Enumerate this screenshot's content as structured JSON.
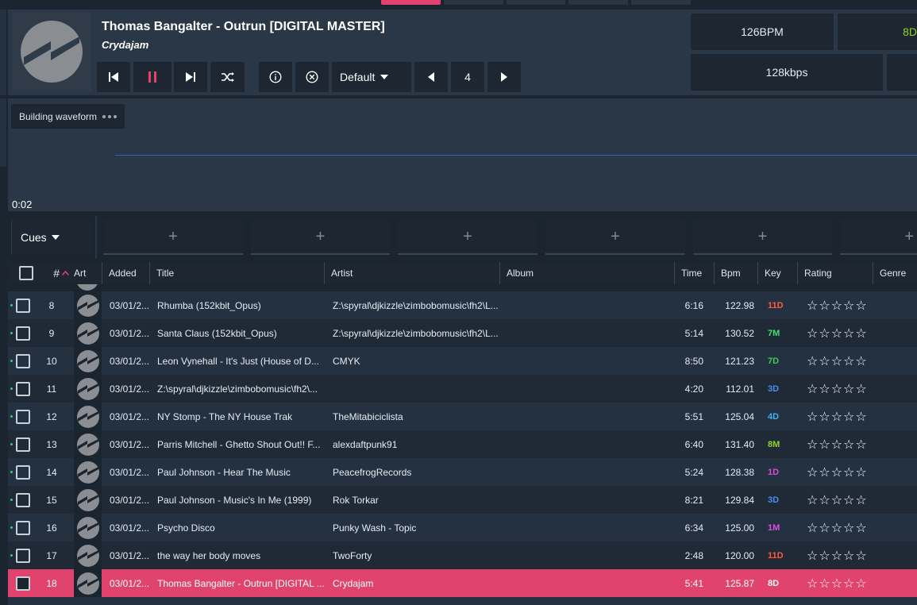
{
  "deck": {
    "title": "Thomas Bangalter - Outrun [DIGITAL MASTER]",
    "artist": "Crydajam",
    "hotcue_preset": "Default",
    "loop_value": "4",
    "bpm": "126BPM",
    "key": "8D",
    "bitrate": "128kbps"
  },
  "waveform": {
    "status": "Building waveform",
    "elapsed": "0:02"
  },
  "cues": {
    "select_label": "Cues",
    "slots": [
      "+",
      "+",
      "+",
      "+",
      "+",
      "+"
    ]
  },
  "table": {
    "headers": {
      "num": "#",
      "art": "Art",
      "added": "Added",
      "title": "Title",
      "artist": "Artist",
      "album": "Album",
      "time": "Time",
      "bpm": "Bpm",
      "key": "Key",
      "rating": "Rating",
      "genre": "Genre"
    },
    "rows": [
      {
        "num": "8",
        "added": "03/01/2...",
        "title": "Rhumba (152kbit_Opus)",
        "artist": "Z:\\spyral\\djkizzle\\zimbobomusic\\fh2\\L...",
        "album": "",
        "time": "6:16",
        "bpm": "122.98",
        "key": "11D",
        "key_color": "#ff5a3c"
      },
      {
        "num": "9",
        "added": "03/01/2...",
        "title": "Santa Claus (152kbit_Opus)",
        "artist": "Z:\\spyral\\djkizzle\\zimbobomusic\\fh2\\L...",
        "album": "",
        "time": "5:14",
        "bpm": "130.52",
        "key": "7M",
        "key_color": "#3ee36a"
      },
      {
        "num": "10",
        "added": "03/01/2...",
        "title": "Leon Vynehall - It's Just (House of D...",
        "artist": "CMYK",
        "album": "",
        "time": "8:50",
        "bpm": "121.23",
        "key": "7D",
        "key_color": "#3ec95a"
      },
      {
        "num": "11",
        "added": "03/01/2...",
        "title": "Z:\\spyral\\djkizzle\\zimbobomusic\\fh2\\...",
        "artist": "",
        "album": "",
        "time": "4:20",
        "bpm": "112.01",
        "key": "3D",
        "key_color": "#4a8cf0"
      },
      {
        "num": "12",
        "added": "03/01/2...",
        "title": "NY Stomp - The NY House Trak",
        "artist": "TheMitabiciclista",
        "album": "",
        "time": "5:51",
        "bpm": "125.04",
        "key": "4D",
        "key_color": "#3fb0f0"
      },
      {
        "num": "13",
        "added": "03/01/2...",
        "title": "Parris Mitchell - Ghetto Shout Out!! F...",
        "artist": "alexdaftpunk91",
        "album": "",
        "time": "6:40",
        "bpm": "131.40",
        "key": "8M",
        "key_color": "#8ed42a"
      },
      {
        "num": "14",
        "added": "03/01/2...",
        "title": "Paul Johnson - Hear The Music",
        "artist": "PeacefrogRecords",
        "album": "",
        "time": "5:24",
        "bpm": "128.38",
        "key": "1D",
        "key_color": "#d94ad6"
      },
      {
        "num": "15",
        "added": "03/01/2...",
        "title": "Paul Johnson - Music's In Me (1999)",
        "artist": "Rok Torkar",
        "album": "",
        "time": "8:21",
        "bpm": "129.84",
        "key": "3D",
        "key_color": "#4a8cf0"
      },
      {
        "num": "16",
        "added": "03/01/2...",
        "title": "Psycho Disco",
        "artist": "Punky Wash - Topic",
        "album": "",
        "time": "6:34",
        "bpm": "125.00",
        "key": "1M",
        "key_color": "#e04ae0"
      },
      {
        "num": "17",
        "added": "03/01/2...",
        "title": "the way her body moves",
        "artist": "TwoForty",
        "album": "",
        "time": "2:48",
        "bpm": "120.00",
        "key": "11D",
        "key_color": "#ff5a3c"
      },
      {
        "num": "18",
        "added": "03/01/2...",
        "title": "Thomas Bangalter - Outrun [DIGITAL ...",
        "artist": "Crydajam",
        "album": "",
        "time": "5:41",
        "bpm": "125.87",
        "key": "8D",
        "key_color": "#ffffff",
        "selected": true
      }
    ]
  },
  "colors": {
    "accent": "#e0436d",
    "panel": "#2a3746",
    "button": "#1d2631"
  }
}
